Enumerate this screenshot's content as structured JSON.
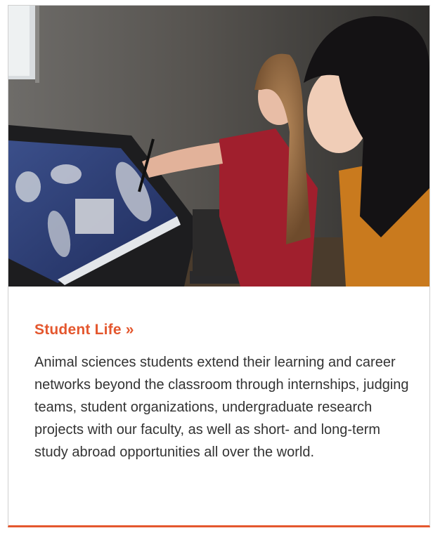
{
  "card": {
    "image_alt": "Two students looking at scan images on a large touchscreen monitor",
    "title": "Student Life",
    "title_icon": "double-chevron-right-icon",
    "title_icon_glyph": "»",
    "description": "Animal sciences students extend their learning and career networks beyond the classroom through internships, judging teams, student organizations, undergraduate research projects with our faculty, as well as short- and long-term study abroad opportunities all over the world.",
    "accent_color": "#e4572e"
  }
}
